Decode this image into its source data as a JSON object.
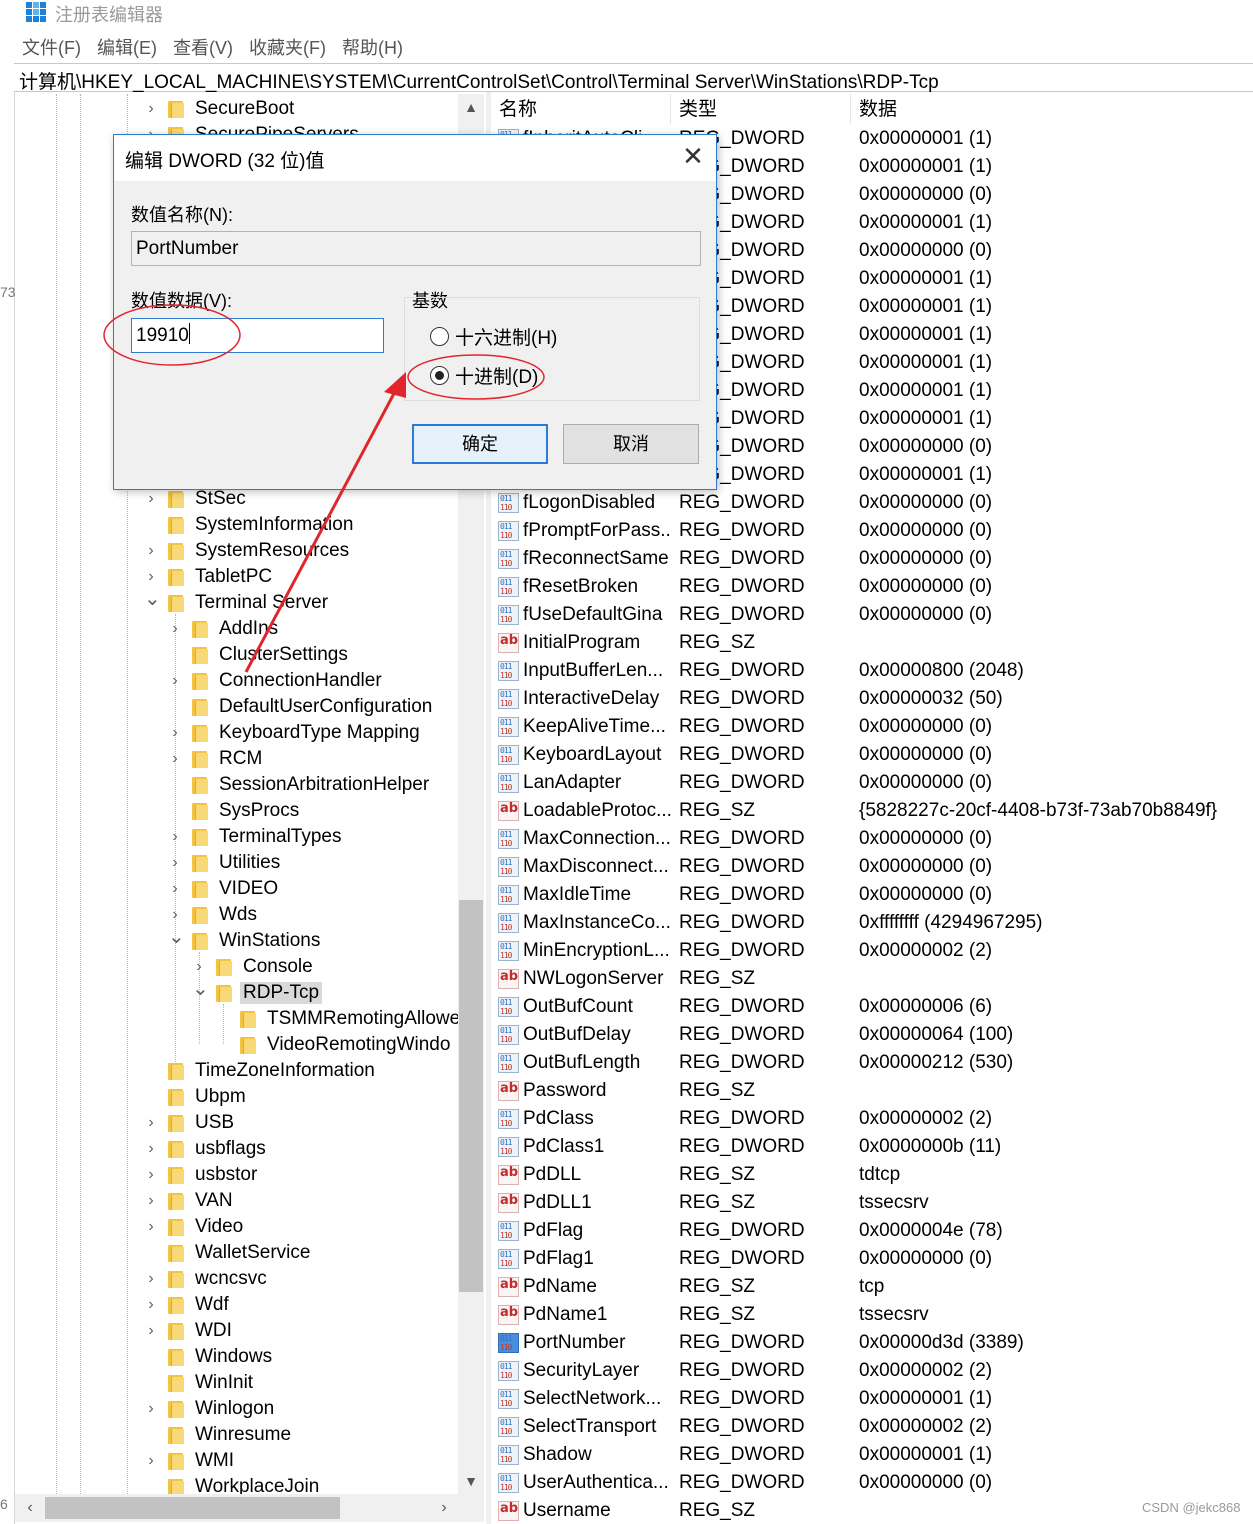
{
  "window": {
    "title": "注册表编辑器",
    "icon": "registry-editor-icon"
  },
  "menu": [
    "文件(F)",
    "编辑(E)",
    "查看(V)",
    "收藏夹(F)",
    "帮助(H)"
  ],
  "address": "计算机\\HKEY_LOCAL_MACHINE\\SYSTEM\\CurrentControlSet\\Control\\Terminal Server\\WinStations\\RDP-Tcp",
  "edge_labels": [
    "73",
    "6"
  ],
  "tree": [
    {
      "label": "SecureBoot",
      "depth": 0,
      "expander": "collapsed"
    },
    {
      "label": "SecurePipeServers",
      "depth": 0,
      "expander": "collapsed"
    },
    {
      "label": "StSec",
      "depth": 0,
      "expander": "collapsed",
      "row": 15
    },
    {
      "label": "SystemInformation",
      "depth": 0,
      "expander": "none",
      "row": 16
    },
    {
      "label": "SystemResources",
      "depth": 0,
      "expander": "collapsed",
      "row": 17
    },
    {
      "label": "TabletPC",
      "depth": 0,
      "expander": "collapsed",
      "row": 18
    },
    {
      "label": "Terminal Server",
      "depth": 0,
      "expander": "expanded",
      "row": 19
    },
    {
      "label": "AddIns",
      "depth": 1,
      "expander": "collapsed",
      "row": 20
    },
    {
      "label": "ClusterSettings",
      "depth": 1,
      "expander": "none",
      "row": 21
    },
    {
      "label": "ConnectionHandler",
      "depth": 1,
      "expander": "collapsed",
      "row": 22
    },
    {
      "label": "DefaultUserConfiguration",
      "depth": 1,
      "expander": "none",
      "row": 23
    },
    {
      "label": "KeyboardType Mapping",
      "depth": 1,
      "expander": "collapsed",
      "row": 24
    },
    {
      "label": "RCM",
      "depth": 1,
      "expander": "collapsed",
      "row": 25
    },
    {
      "label": "SessionArbitrationHelper",
      "depth": 1,
      "expander": "none",
      "row": 26
    },
    {
      "label": "SysProcs",
      "depth": 1,
      "expander": "none",
      "row": 27
    },
    {
      "label": "TerminalTypes",
      "depth": 1,
      "expander": "collapsed",
      "row": 28
    },
    {
      "label": "Utilities",
      "depth": 1,
      "expander": "collapsed",
      "row": 29
    },
    {
      "label": "VIDEO",
      "depth": 1,
      "expander": "collapsed",
      "row": 30
    },
    {
      "label": "Wds",
      "depth": 1,
      "expander": "collapsed",
      "row": 31
    },
    {
      "label": "WinStations",
      "depth": 1,
      "expander": "expanded",
      "row": 32
    },
    {
      "label": "Console",
      "depth": 2,
      "expander": "collapsed",
      "row": 33
    },
    {
      "label": "RDP-Tcp",
      "depth": 2,
      "expander": "expanded",
      "row": 34,
      "selected": true
    },
    {
      "label": "TSMMRemotingAllowe",
      "depth": 3,
      "expander": "none",
      "row": 35
    },
    {
      "label": "VideoRemotingWindo",
      "depth": 3,
      "expander": "none",
      "row": 36
    },
    {
      "label": "TimeZoneInformation",
      "depth": 0,
      "expander": "none",
      "row": 37
    },
    {
      "label": "Ubpm",
      "depth": 0,
      "expander": "none",
      "row": 38
    },
    {
      "label": "USB",
      "depth": 0,
      "expander": "collapsed",
      "row": 39
    },
    {
      "label": "usbflags",
      "depth": 0,
      "expander": "collapsed",
      "row": 40
    },
    {
      "label": "usbstor",
      "depth": 0,
      "expander": "collapsed",
      "row": 41
    },
    {
      "label": "VAN",
      "depth": 0,
      "expander": "collapsed",
      "row": 42
    },
    {
      "label": "Video",
      "depth": 0,
      "expander": "collapsed",
      "row": 43
    },
    {
      "label": "WalletService",
      "depth": 0,
      "expander": "none",
      "row": 44
    },
    {
      "label": "wcncsvc",
      "depth": 0,
      "expander": "collapsed",
      "row": 45
    },
    {
      "label": "Wdf",
      "depth": 0,
      "expander": "collapsed",
      "row": 46
    },
    {
      "label": "WDI",
      "depth": 0,
      "expander": "collapsed",
      "row": 47
    },
    {
      "label": "Windows",
      "depth": 0,
      "expander": "none",
      "row": 48
    },
    {
      "label": "WinInit",
      "depth": 0,
      "expander": "none",
      "row": 49
    },
    {
      "label": "Winlogon",
      "depth": 0,
      "expander": "collapsed",
      "row": 50
    },
    {
      "label": "Winresume",
      "depth": 0,
      "expander": "none",
      "row": 51
    },
    {
      "label": "WMI",
      "depth": 0,
      "expander": "collapsed",
      "row": 52
    },
    {
      "label": "WorkplaceJoin",
      "depth": 0,
      "expander": "none",
      "row": 53
    }
  ],
  "list": {
    "columns": [
      "名称",
      "类型",
      "数据"
    ],
    "rows": [
      {
        "name": "fInheritAutoCli...",
        "type": "REG_DWORD",
        "data": "0x00000001 (1)",
        "kind": "dword"
      },
      {
        "name": "",
        "type": "REG_DWORD",
        "data": "0x00000001 (1)",
        "kind": "dword"
      },
      {
        "name": "",
        "type": "REG_DWORD",
        "data": "0x00000000 (0)",
        "kind": "dword"
      },
      {
        "name": "",
        "type": "REG_DWORD",
        "data": "0x00000001 (1)",
        "kind": "dword"
      },
      {
        "name": "",
        "type": "REG_DWORD",
        "data": "0x00000000 (0)",
        "kind": "dword"
      },
      {
        "name": "",
        "type": "REG_DWORD",
        "data": "0x00000001 (1)",
        "kind": "dword"
      },
      {
        "name": "",
        "type": "REG_DWORD",
        "data": "0x00000001 (1)",
        "kind": "dword"
      },
      {
        "name": "",
        "type": "REG_DWORD",
        "data": "0x00000001 (1)",
        "kind": "dword"
      },
      {
        "name": "",
        "type": "REG_DWORD",
        "data": "0x00000001 (1)",
        "kind": "dword"
      },
      {
        "name": "",
        "type": "REG_DWORD",
        "data": "0x00000001 (1)",
        "kind": "dword"
      },
      {
        "name": "",
        "type": "REG_DWORD",
        "data": "0x00000001 (1)",
        "kind": "dword"
      },
      {
        "name": "",
        "type": "REG_DWORD",
        "data": "0x00000000 (0)",
        "kind": "dword"
      },
      {
        "name": "",
        "type": "REG_DWORD",
        "data": "0x00000001 (1)",
        "kind": "dword"
      },
      {
        "name": "fLogonDisabled",
        "type": "REG_DWORD",
        "data": "0x00000000 (0)",
        "kind": "dword"
      },
      {
        "name": "fPromptForPass...",
        "type": "REG_DWORD",
        "data": "0x00000000 (0)",
        "kind": "dword"
      },
      {
        "name": "fReconnectSame",
        "type": "REG_DWORD",
        "data": "0x00000000 (0)",
        "kind": "dword"
      },
      {
        "name": "fResetBroken",
        "type": "REG_DWORD",
        "data": "0x00000000 (0)",
        "kind": "dword"
      },
      {
        "name": "fUseDefaultGina",
        "type": "REG_DWORD",
        "data": "0x00000000 (0)",
        "kind": "dword"
      },
      {
        "name": "InitialProgram",
        "type": "REG_SZ",
        "data": "",
        "kind": "sz"
      },
      {
        "name": "InputBufferLen...",
        "type": "REG_DWORD",
        "data": "0x00000800 (2048)",
        "kind": "dword"
      },
      {
        "name": "InteractiveDelay",
        "type": "REG_DWORD",
        "data": "0x00000032 (50)",
        "kind": "dword"
      },
      {
        "name": "KeepAliveTime...",
        "type": "REG_DWORD",
        "data": "0x00000000 (0)",
        "kind": "dword"
      },
      {
        "name": "KeyboardLayout",
        "type": "REG_DWORD",
        "data": "0x00000000 (0)",
        "kind": "dword"
      },
      {
        "name": "LanAdapter",
        "type": "REG_DWORD",
        "data": "0x00000000 (0)",
        "kind": "dword"
      },
      {
        "name": "LoadableProtoc...",
        "type": "REG_SZ",
        "data": "{5828227c-20cf-4408-b73f-73ab70b8849f}",
        "kind": "sz"
      },
      {
        "name": "MaxConnection...",
        "type": "REG_DWORD",
        "data": "0x00000000 (0)",
        "kind": "dword"
      },
      {
        "name": "MaxDisconnect...",
        "type": "REG_DWORD",
        "data": "0x00000000 (0)",
        "kind": "dword"
      },
      {
        "name": "MaxIdleTime",
        "type": "REG_DWORD",
        "data": "0x00000000 (0)",
        "kind": "dword"
      },
      {
        "name": "MaxInstanceCo...",
        "type": "REG_DWORD",
        "data": "0xffffffff (4294967295)",
        "kind": "dword"
      },
      {
        "name": "MinEncryptionL...",
        "type": "REG_DWORD",
        "data": "0x00000002 (2)",
        "kind": "dword"
      },
      {
        "name": "NWLogonServer",
        "type": "REG_SZ",
        "data": "",
        "kind": "sz"
      },
      {
        "name": "OutBufCount",
        "type": "REG_DWORD",
        "data": "0x00000006 (6)",
        "kind": "dword"
      },
      {
        "name": "OutBufDelay",
        "type": "REG_DWORD",
        "data": "0x00000064 (100)",
        "kind": "dword"
      },
      {
        "name": "OutBufLength",
        "type": "REG_DWORD",
        "data": "0x00000212 (530)",
        "kind": "dword"
      },
      {
        "name": "Password",
        "type": "REG_SZ",
        "data": "",
        "kind": "sz"
      },
      {
        "name": "PdClass",
        "type": "REG_DWORD",
        "data": "0x00000002 (2)",
        "kind": "dword"
      },
      {
        "name": "PdClass1",
        "type": "REG_DWORD",
        "data": "0x0000000b (11)",
        "kind": "dword"
      },
      {
        "name": "PdDLL",
        "type": "REG_SZ",
        "data": "tdtcp",
        "kind": "sz"
      },
      {
        "name": "PdDLL1",
        "type": "REG_SZ",
        "data": "tssecsrv",
        "kind": "sz"
      },
      {
        "name": "PdFlag",
        "type": "REG_DWORD",
        "data": "0x0000004e (78)",
        "kind": "dword"
      },
      {
        "name": "PdFlag1",
        "type": "REG_DWORD",
        "data": "0x00000000 (0)",
        "kind": "dword"
      },
      {
        "name": "PdName",
        "type": "REG_SZ",
        "data": "tcp",
        "kind": "sz"
      },
      {
        "name": "PdName1",
        "type": "REG_SZ",
        "data": "tssecsrv",
        "kind": "sz"
      },
      {
        "name": "PortNumber",
        "type": "REG_DWORD",
        "data": "0x00000d3d (3389)",
        "kind": "dword",
        "selected": true
      },
      {
        "name": "SecurityLayer",
        "type": "REG_DWORD",
        "data": "0x00000002 (2)",
        "kind": "dword"
      },
      {
        "name": "SelectNetwork...",
        "type": "REG_DWORD",
        "data": "0x00000001 (1)",
        "kind": "dword"
      },
      {
        "name": "SelectTransport",
        "type": "REG_DWORD",
        "data": "0x00000002 (2)",
        "kind": "dword"
      },
      {
        "name": "Shadow",
        "type": "REG_DWORD",
        "data": "0x00000001 (1)",
        "kind": "dword"
      },
      {
        "name": "UserAuthentica...",
        "type": "REG_DWORD",
        "data": "0x00000000 (0)",
        "kind": "dword"
      },
      {
        "name": "Username",
        "type": "REG_SZ",
        "data": "",
        "kind": "sz"
      }
    ]
  },
  "dialog": {
    "title": "编辑 DWORD (32 位)值",
    "name_label": "数值名称(N):",
    "name_value": "PortNumber",
    "data_label": "数值数据(V):",
    "data_value": "19910",
    "base_label": "基数",
    "radio_hex": "十六进制(H)",
    "radio_dec": "十进制(D)",
    "selected_base": "decimal",
    "ok": "确定",
    "cancel": "取消",
    "close_glyph": "✕"
  },
  "annotation_color": "#e0262c",
  "watermark": "CSDN @jekc868"
}
